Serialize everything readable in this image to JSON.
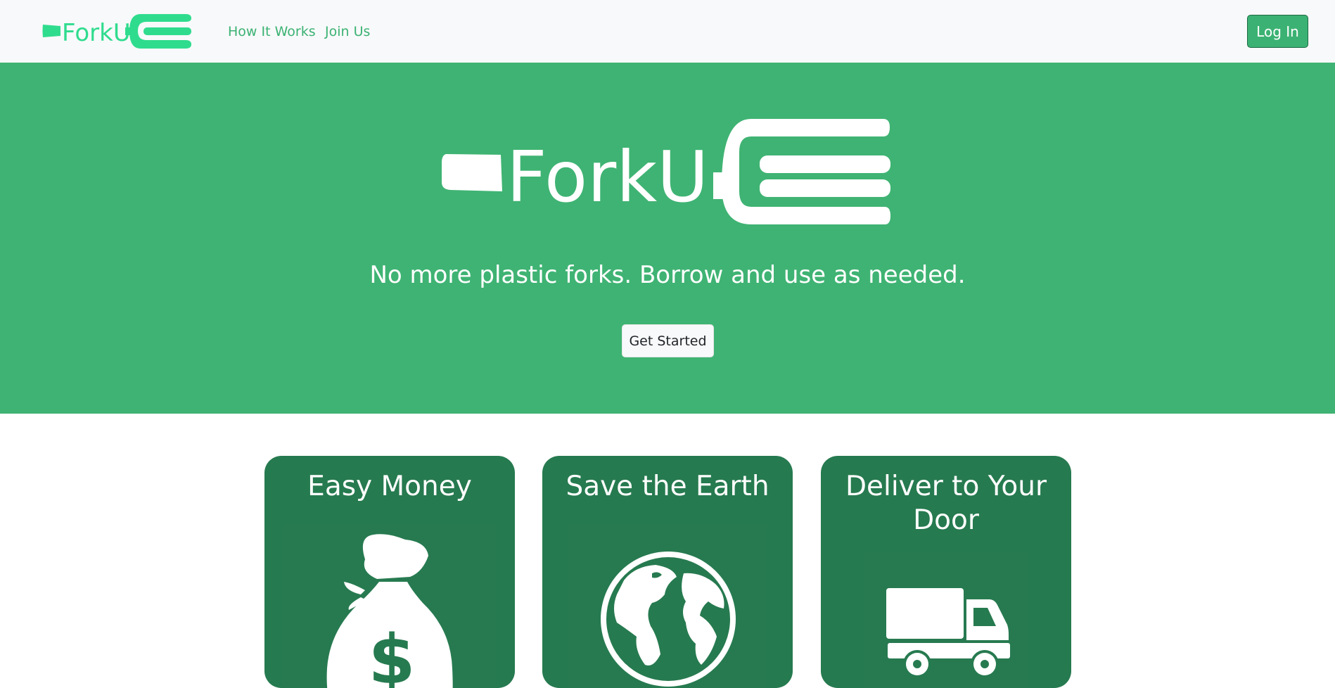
{
  "navbar": {
    "brand_text": "ForkU",
    "links": [
      "How It Works",
      "Join Us"
    ],
    "login_label": "Log In"
  },
  "hero": {
    "logo_text": "ForkU",
    "tagline": "No more plastic forks. Borrow and use as needed.",
    "cta_label": "Get Started"
  },
  "features": [
    {
      "title": "Easy Money",
      "icon": "money-bag-icon"
    },
    {
      "title": "Save the Earth",
      "icon": "globe-icon"
    },
    {
      "title": "Deliver to Your Door",
      "icon": "delivery-truck-icon"
    }
  ],
  "colors": {
    "brand_green": "#3bb273",
    "hero_bg": "#3fb373",
    "card_bg": "#267a4f",
    "navbar_bg": "#f8f9fa",
    "logo_green": "#2fdc8e"
  }
}
